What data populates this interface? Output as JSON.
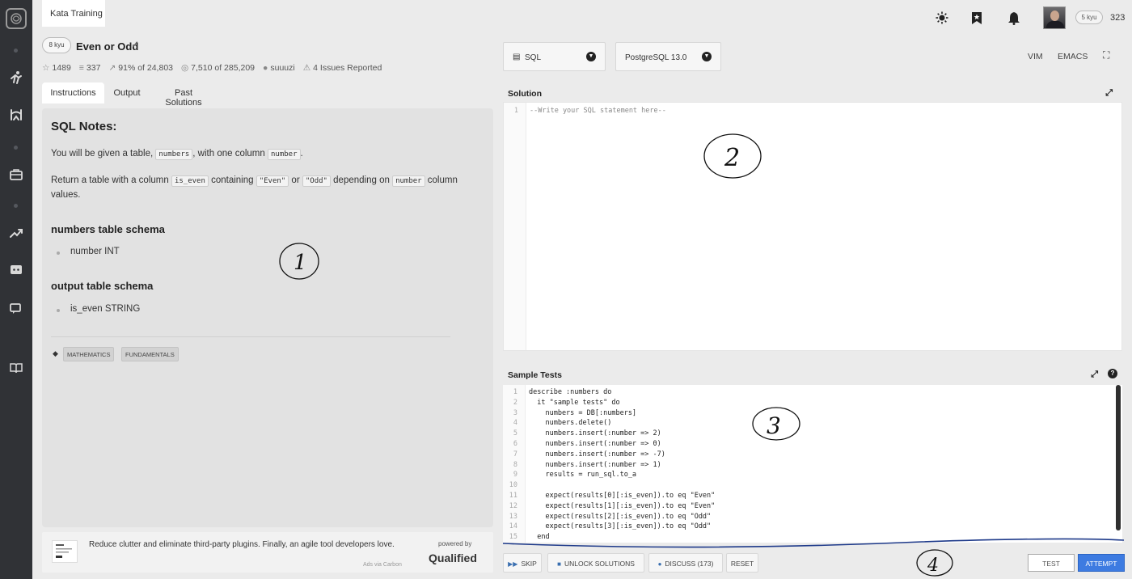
{
  "topbar": {
    "tab_label": "Kata Training",
    "honor": "323",
    "rank_badge": "5 kyu"
  },
  "kata": {
    "rank": "8 kyu",
    "title": "Even or Odd",
    "stats": {
      "favorites": "1489",
      "collections": "337",
      "satisfaction": "91%",
      "satisfaction_of": "of 24,803",
      "completed": "7,510",
      "completed_of": "of 285,209",
      "author": "suuuzi",
      "issues": "4 Issues Reported"
    }
  },
  "tabs": [
    "Instructions",
    "Output",
    "Past Solutions"
  ],
  "instructions": {
    "heading": "SQL Notes:",
    "p1_a": "You will be given a table, ",
    "p1_code1": "numbers",
    "p1_b": ", with one column ",
    "p1_code2": "number",
    "p1_c": ".",
    "p2_a": "Return a table with a column ",
    "p2_code1": "is_even",
    "p2_b": " containing ",
    "p2_code2": "\"Even\"",
    "p2_c": " or ",
    "p2_code3": "\"Odd\"",
    "p2_d": " depending on ",
    "p2_code4": "number",
    "p2_e": " column values.",
    "schema1_title": "numbers table schema",
    "schema1_item": "number INT",
    "schema2_title": "output table schema",
    "schema2_item": "is_even STRING",
    "tags": [
      "MATHEMATICS",
      "FUNDAMENTALS"
    ]
  },
  "ad": {
    "text": "Reduce clutter and eliminate third-party plugins. Finally, an agile tool developers love.",
    "via": "Ads via Carbon",
    "powered_by": "powered by",
    "brand": "Qualified"
  },
  "language_select": "SQL",
  "version_select": "PostgreSQL 13.0",
  "modes": [
    "VIM",
    "EMACS"
  ],
  "solution": {
    "title": "Solution",
    "lines": [
      "--Write your SQL statement here--"
    ]
  },
  "sample_tests": {
    "title": "Sample Tests",
    "lines": [
      "describe :numbers do",
      "  it \"sample tests\" do",
      "    numbers = DB[:numbers]",
      "    numbers.delete()",
      "    numbers.insert(:number => 2)",
      "    numbers.insert(:number => 0)",
      "    numbers.insert(:number => -7)",
      "    numbers.insert(:number => 1)",
      "    results = run_sql.to_a",
      "",
      "    expect(results[0][:is_even]).to eq \"Even\"",
      "    expect(results[1][:is_even]).to eq \"Even\"",
      "    expect(results[2][:is_even]).to eq \"Odd\"",
      "    expect(results[3][:is_even]).to eq \"Odd\"",
      "  end"
    ]
  },
  "footer": {
    "skip": "SKIP",
    "unlock": "UNLOCK SOLUTIONS",
    "discuss": "DISCUSS (173)",
    "reset": "RESET",
    "test": "TEST",
    "attempt": "ATTEMPT"
  },
  "annotations": [
    "1",
    "2",
    "3",
    "4"
  ],
  "colors": {
    "sidebar": "#303236",
    "attempt_button": "#3d7be1",
    "panel_bg": "#e2e2e2"
  }
}
